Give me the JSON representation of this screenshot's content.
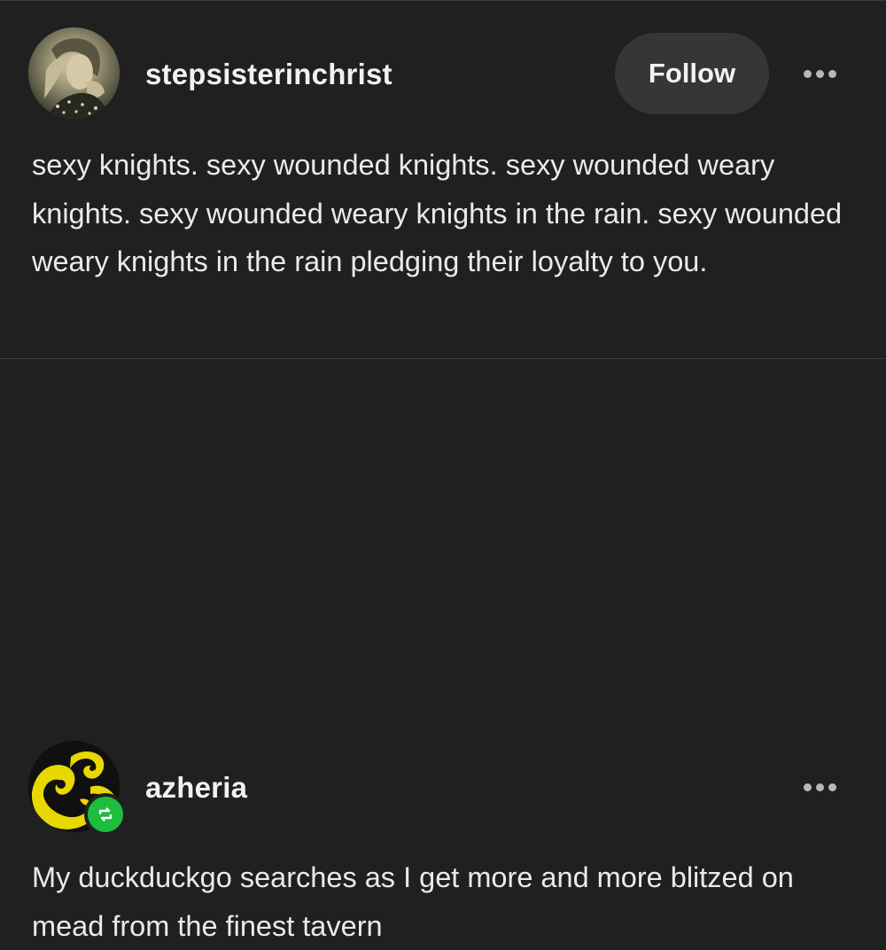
{
  "posts": [
    {
      "username": "stepsisterinchrist",
      "follow_label": "Follow",
      "text": "sexy knights. sexy wounded knights. sexy wounded weary knights. sexy wounded weary knights in the rain. sexy wounded weary knights in the rain pledging their loyalty to you."
    },
    {
      "username": "azheria",
      "text": "My duckduckgo searches as I get more and more blitzed on mead from the finest tavern",
      "reblog_icon": "reblog-icon"
    }
  ],
  "icons": {
    "more": "more-options-icon",
    "reblog": "reblog-icon"
  },
  "colors": {
    "background": "#202020",
    "follow_button_bg": "#363636",
    "reblog_badge": "#1ebd3d",
    "text": "#eaeaea"
  }
}
